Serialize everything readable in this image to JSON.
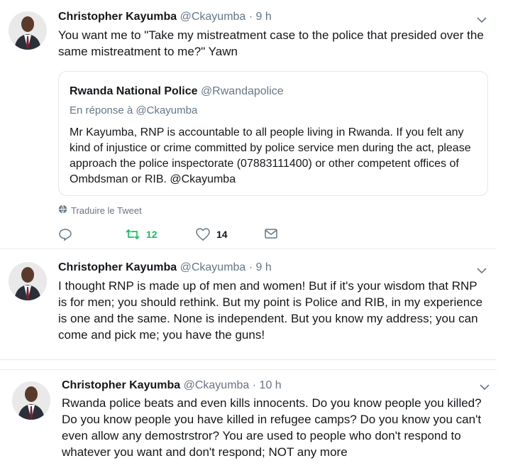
{
  "tweets": [
    {
      "name": "Christopher Kayumba",
      "handle": "@Ckayumba",
      "time": "· 9 h",
      "text": "You want me to \"Take my mistreatment case to the police that presided over the same mistreatment to me?\" Yawn",
      "quote": {
        "name": "Rwanda National Police",
        "handle": "@Rwandapolice",
        "reply": "En réponse à @Ckayumba",
        "text": "Mr Kayumba, RNP is accountable to all people living in Rwanda. If you felt any kind of injustice or crime committed by police service men during the act, please approach the police inspectorate (07883111400) or other competent offices of Ombdsman or RIB. @Ckayumba"
      },
      "translate": "Traduire le Tweet",
      "retweets": "12",
      "likes": "14"
    },
    {
      "name": "Christopher Kayumba",
      "handle": "@Ckayumba",
      "time": "· 9 h",
      "text": "I thought RNP is made up of men and women! But if it's your wisdom that RNP is for men; you should rethink. But my point is Police and RIB, in my experience is one and the same. None is independent. But you know my address; you can come and pick me; you have the guns!"
    },
    {
      "name": "Christopher Kayumba",
      "handle": "@Ckayumba",
      "time": "· 10 h",
      "text": "Rwanda police beats and even kills innocents. Do you know people you killed? Do you know people you have killed in refugee camps? Do you know you can't even allow any demostrstror? You are used to people who don't respond to whatever you want and don't respond; NOT any more"
    }
  ],
  "icons": {
    "reply": "reply-icon",
    "retweet": "retweet-icon",
    "like": "heart-icon",
    "message": "envelope-icon",
    "translate": "globe-icon",
    "caret": "chevron-down-icon"
  },
  "colors": {
    "retweet_active": "#17bf63",
    "secondary_text": "#657786",
    "icon": "#657786"
  }
}
